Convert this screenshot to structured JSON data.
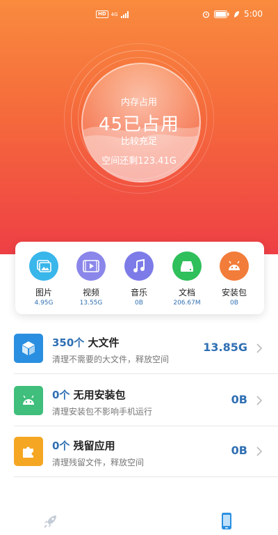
{
  "status_bar": {
    "left_badge": "HD",
    "left_small": "4G",
    "time": "5:00"
  },
  "storage": {
    "title": "内存占用",
    "main": "45已占用",
    "status": "比较充足",
    "remaining": "空间还剩123.41G"
  },
  "categories": [
    {
      "label": "图片",
      "size": "4.95G",
      "icon": "image-icon",
      "color": "#39b6ea"
    },
    {
      "label": "视频",
      "size": "13.55G",
      "icon": "video-icon",
      "color": "#8a86ea"
    },
    {
      "label": "音乐",
      "size": "0B",
      "icon": "music-icon",
      "color": "#7c7be8"
    },
    {
      "label": "文档",
      "size": "206.67M",
      "icon": "document-icon",
      "color": "#2fbf5b"
    },
    {
      "label": "安装包",
      "size": "0B",
      "icon": "android-icon",
      "color": "#f27c3a"
    }
  ],
  "items": [
    {
      "count": "350个",
      "name": "大文件",
      "desc": "清理不需要的大文件，释放空间",
      "size": "13.85G",
      "icon": "cube-icon",
      "color": "#2a8fe0"
    },
    {
      "count": "0个",
      "name": "无用安装包",
      "desc": "清理安装包不影响手机运行",
      "size": "0B",
      "icon": "android-icon",
      "color": "#3fbe7c"
    },
    {
      "count": "0个",
      "name": "残留应用",
      "desc": "清理残留文件，释放空间",
      "size": "0B",
      "icon": "puzzle-icon",
      "color": "#f5a623"
    }
  ],
  "bottom_nav": [
    {
      "icon": "rocket-icon"
    },
    {
      "icon": "phone-icon"
    }
  ]
}
